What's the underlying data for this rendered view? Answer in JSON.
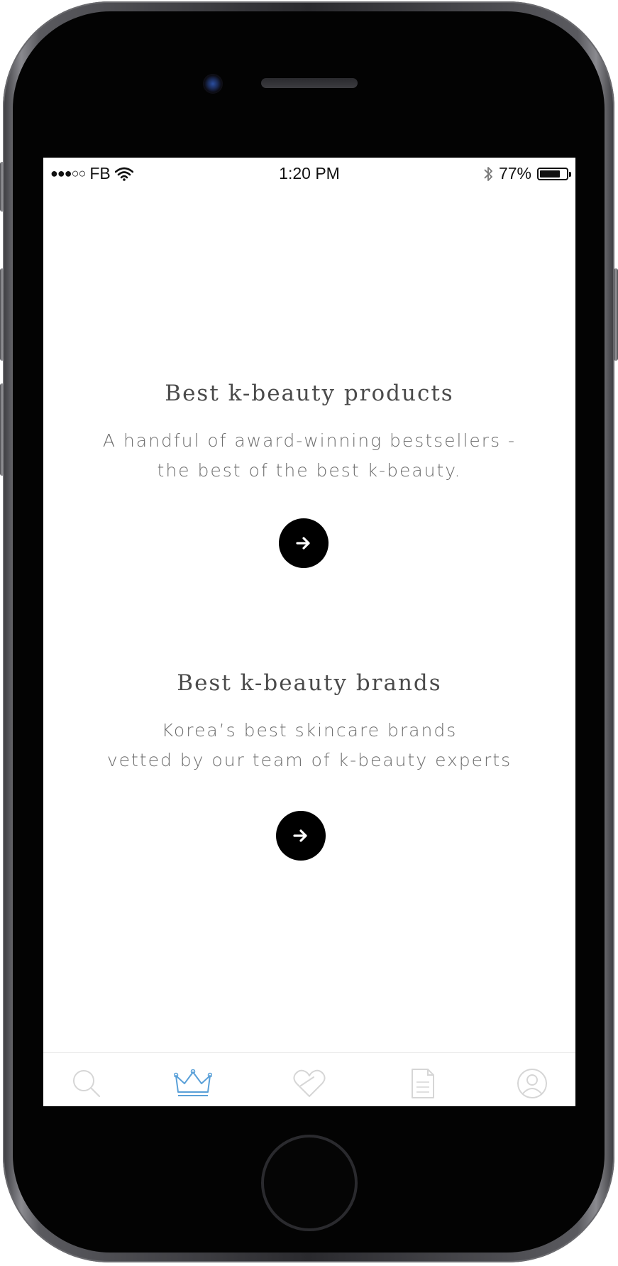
{
  "status_bar": {
    "signal": "●●●○○",
    "carrier": "FB",
    "time": "1:20 PM",
    "battery_percent": "77%",
    "battery_level": 0.77
  },
  "sections": [
    {
      "title": "Best k-beauty products",
      "description_lines": [
        "A handful of award-winning bestsellers -",
        "the best of the best k-beauty."
      ],
      "button_icon": "arrow-right-icon"
    },
    {
      "title": "Best k-beauty brands",
      "description_lines": [
        "Korea’s best skincare brands",
        "vetted by our team of k-beauty experts"
      ],
      "button_icon": "arrow-right-icon"
    }
  ],
  "tab_bar": {
    "tabs": [
      {
        "icon": "search-icon",
        "active": false
      },
      {
        "icon": "crown-icon",
        "active": true
      },
      {
        "icon": "heart-icon",
        "active": false
      },
      {
        "icon": "document-icon",
        "active": false
      },
      {
        "icon": "profile-icon",
        "active": false
      }
    ],
    "active_color": "#5aa0d8",
    "inactive_color": "#d6d6d6"
  }
}
